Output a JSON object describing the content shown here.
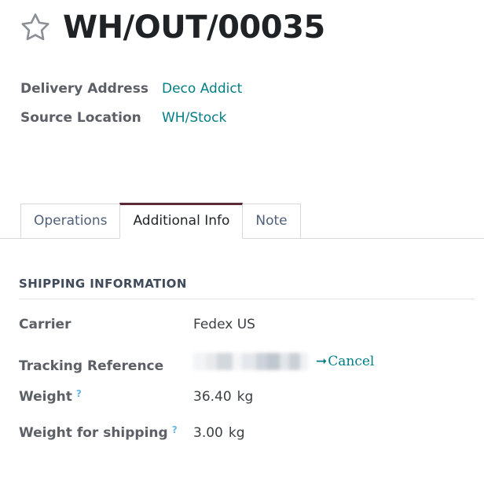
{
  "record": {
    "title": "WH/OUT/00035",
    "favorite_icon": "star-outline-icon",
    "favorite_active": false
  },
  "header_fields": [
    {
      "label": "Delivery Address",
      "value": "Deco Addict",
      "is_link": true
    },
    {
      "label": "Source Location",
      "value": "WH/Stock",
      "is_link": true
    }
  ],
  "tabs": [
    {
      "label": "Operations",
      "active": false
    },
    {
      "label": "Additional Info",
      "active": true
    },
    {
      "label": "Note",
      "active": false
    }
  ],
  "section": {
    "title": "Shipping Information",
    "fields": [
      {
        "label": "Carrier",
        "help": "",
        "value": "Fedex US",
        "unit": ""
      },
      {
        "label": "Tracking Reference",
        "help": "",
        "value": "",
        "unit": "",
        "redacted": true,
        "action_label": "Cancel",
        "action_icon": "arrow-right-icon"
      },
      {
        "label": "Weight",
        "help": "?",
        "value": "36.40",
        "unit": "kg"
      },
      {
        "label": "Weight for shipping",
        "help": "?",
        "value": "3.00",
        "unit": "kg"
      }
    ]
  },
  "colors": {
    "link": "#017e84",
    "active_tab_border": "#5c2936",
    "label": "#5c6066",
    "help": "#63b6e8",
    "title": "#1f2326"
  }
}
